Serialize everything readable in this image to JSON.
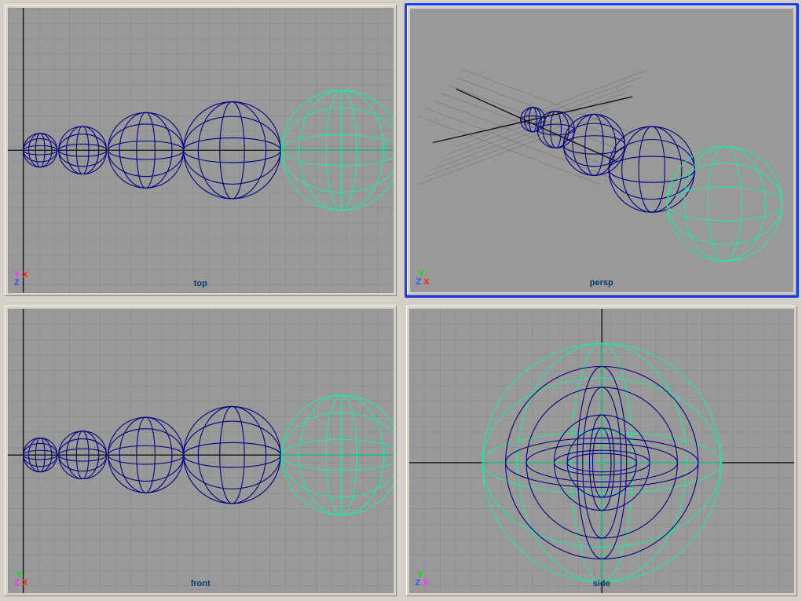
{
  "viewports": {
    "top": {
      "label": "top",
      "active": false,
      "axes": [
        [
          "Y",
          "y"
        ],
        [
          "X",
          "x"
        ],
        [
          "Z",
          "z"
        ]
      ]
    },
    "persp": {
      "label": "persp",
      "active": true,
      "axes": [
        [
          "Y",
          "y"
        ],
        [
          "Z",
          "z"
        ],
        [
          "X",
          "x"
        ]
      ]
    },
    "front": {
      "label": "front",
      "active": false,
      "axes": [
        [
          "Y",
          "y"
        ],
        [
          "Z",
          "z"
        ],
        [
          "X",
          "x"
        ]
      ]
    },
    "side": {
      "label": "side",
      "active": false,
      "axes": [
        [
          "Y",
          "y"
        ],
        [
          "Z",
          "z"
        ],
        [
          "X",
          "x"
        ]
      ]
    }
  },
  "scene": {
    "spheres": [
      {
        "x": 0.9,
        "r": 0.9,
        "selected": false
      },
      {
        "x": 3.0,
        "r": 1.25,
        "selected": false
      },
      {
        "x": 6.2,
        "r": 1.95,
        "selected": false
      },
      {
        "x": 10.6,
        "r": 2.5,
        "selected": false
      },
      {
        "x": 16.2,
        "r": 3.1,
        "selected": true
      }
    ],
    "colors": {
      "wire": "#000080",
      "selected": "#20e8a0",
      "grid": "#888888",
      "axis": "#111111"
    }
  }
}
